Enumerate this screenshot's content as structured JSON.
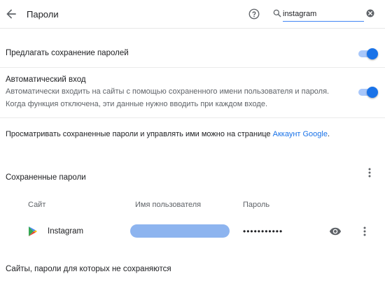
{
  "header": {
    "title": "Пароли",
    "search_value": "instagram"
  },
  "settings": {
    "offer_save": {
      "label": "Предлагать сохранение паролей",
      "enabled": true
    },
    "auto_signin": {
      "label": "Автоматический вход",
      "description_line1": "Автоматически входить на сайты с помощью сохраненного имени пользователя и пароля.",
      "description_line2": "Когда функция отключена, эти данные нужно вводить при каждом входе.",
      "enabled": true
    },
    "manage_text": "Просматривать сохраненные пароли и управлять ими можно на странице ",
    "manage_link": "Аккаунт Google",
    "manage_suffix": "."
  },
  "saved_passwords": {
    "title": "Сохраненные пароли",
    "columns": {
      "site": "Сайт",
      "username": "Имя пользователя",
      "password": "Пароль"
    },
    "rows": [
      {
        "site": "Instagram",
        "password_mask": "•••••••••••"
      }
    ]
  },
  "never_saved": {
    "title": "Сайты, пароли для которых не сохраняются"
  },
  "colors": {
    "accent": "#1a73e8",
    "toggle_track": "#a8c7fa",
    "username_blur": "#8db4ef"
  }
}
